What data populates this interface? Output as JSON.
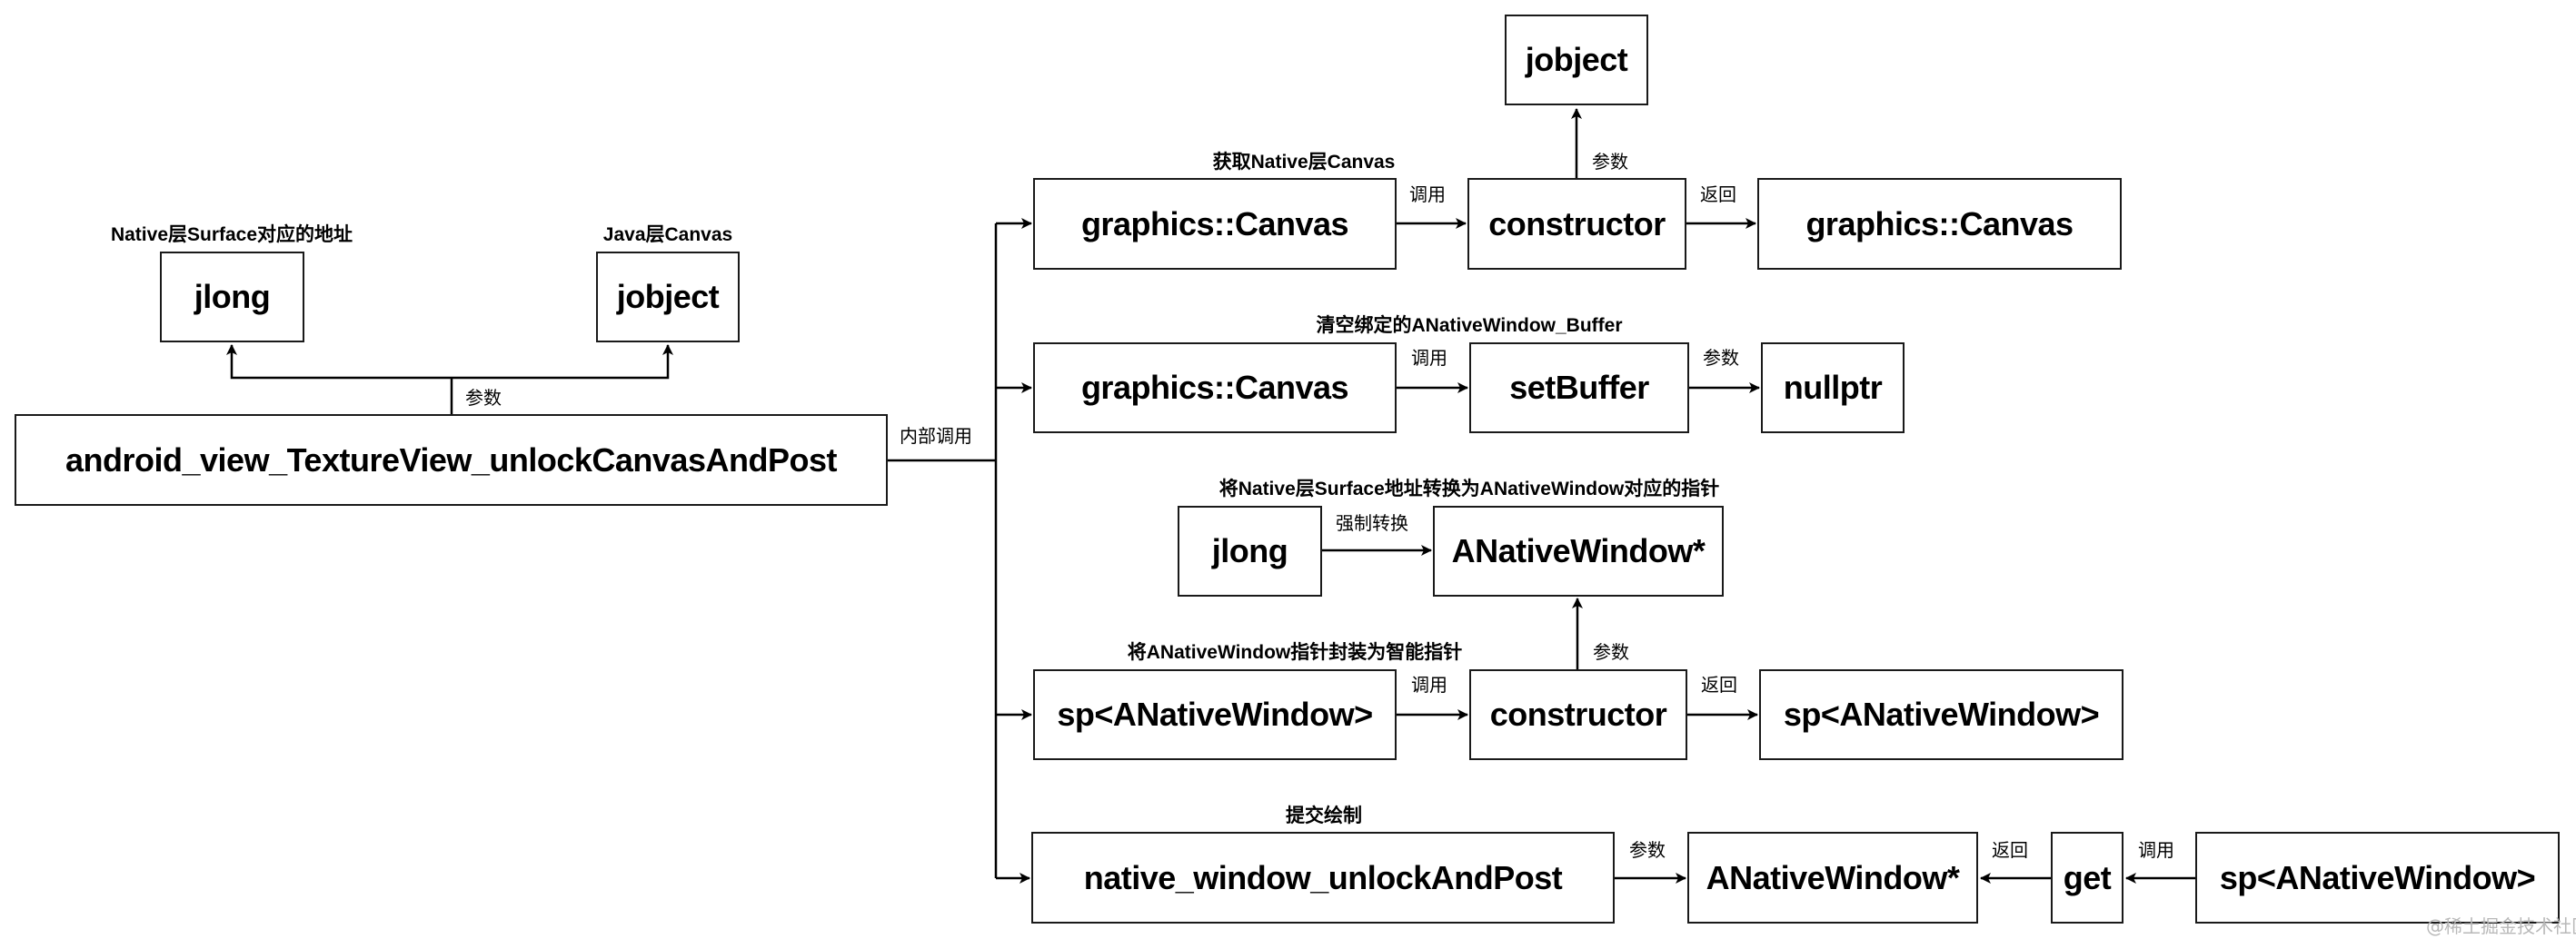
{
  "nodes": {
    "main": "android_view_TextureView_unlockCanvasAndPost",
    "param_jlong": "jlong",
    "param_jobject": "jobject",
    "r1_canvas": "graphics::Canvas",
    "r1_constructor": "constructor",
    "r1_result": "graphics::Canvas",
    "r1_jobject": "jobject",
    "r2_canvas": "graphics::Canvas",
    "r2_setbuffer": "setBuffer",
    "r2_nullptr": "nullptr",
    "r3_jlong": "jlong",
    "r3_anw": "ANativeWindow*",
    "r4_sp": "sp<ANativeWindow>",
    "r4_constructor": "constructor",
    "r4_result": "sp<ANativeWindow>",
    "r5_post": "native_window_unlockAndPost",
    "r5_anw": "ANativeWindow*",
    "r5_get": "get",
    "r5_sp": "sp<ANativeWindow>"
  },
  "titles": {
    "param_jlong": "Native层Surface对应的地址",
    "param_jobject": "Java层Canvas",
    "row1": "获取Native层Canvas",
    "row2": "清空绑定的ANativeWindow_Buffer",
    "row3": "将Native层Surface地址转换为ANativeWindow对应的指针",
    "row4": "将ANativeWindow指针封装为智能指针",
    "row5": "提交绘制"
  },
  "edge_labels": {
    "main_params": "参数",
    "internal_call": "内部调用",
    "r1_call": "调用",
    "r1_param": "参数",
    "r1_return": "返回",
    "r2_call": "调用",
    "r2_param": "参数",
    "r3_cast": "强制转换",
    "r4_param": "参数",
    "r4_call": "调用",
    "r4_return": "返回",
    "r5_param": "参数",
    "r5_return": "返回",
    "r5_call": "调用"
  },
  "watermark": "@稀土掘金技术社区"
}
